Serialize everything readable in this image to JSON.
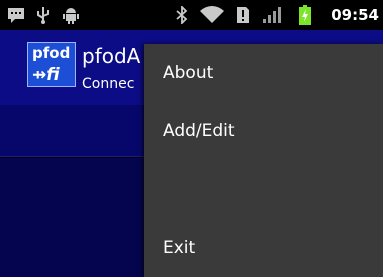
{
  "status_bar": {
    "icons": [
      "chat-icon",
      "usb-icon",
      "android-debug-icon",
      "bluetooth-icon",
      "wifi-icon",
      "sim-alert-icon",
      "signal-icon",
      "battery-charging-icon"
    ],
    "time": "09:54"
  },
  "app": {
    "logo": {
      "top": "pfod",
      "bottom": "⇸fi"
    },
    "title": "pfodA",
    "subtitle": "Connec"
  },
  "menu": {
    "items": [
      {
        "label": "About"
      },
      {
        "label": "Add/Edit"
      },
      {
        "label": ""
      },
      {
        "label": "Exit"
      }
    ]
  },
  "colors": {
    "action_bar": "#0c0c86",
    "menu_bg": "#3a3a3a",
    "battery": "#7be52a"
  }
}
